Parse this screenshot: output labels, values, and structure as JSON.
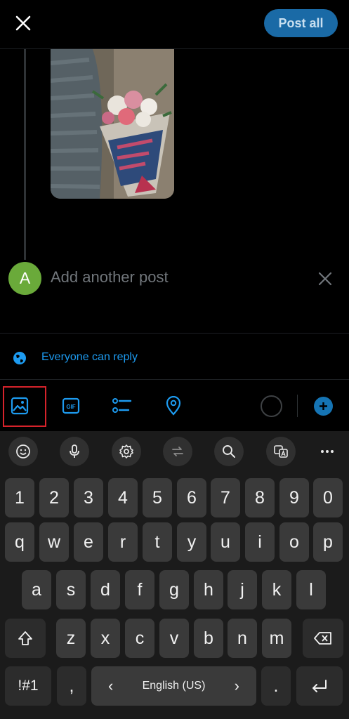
{
  "header": {
    "close_icon": "close-icon",
    "post_all_label": "Post all"
  },
  "composer": {
    "avatar_letter": "A",
    "add_post_placeholder": "Add another post"
  },
  "reply_setting": {
    "icon": "globe-icon",
    "label": "Everyone can reply"
  },
  "toolbar": {
    "items": [
      "image-icon",
      "gif-icon",
      "poll-icon",
      "location-icon"
    ],
    "gif_text": "GIF"
  },
  "keyboard": {
    "toolbar_icons": [
      "emoji-icon",
      "microphone-icon",
      "settings-icon",
      "swap-icon",
      "search-icon",
      "translate-icon",
      "more-icon"
    ],
    "number_row": [
      "1",
      "2",
      "3",
      "4",
      "5",
      "6",
      "7",
      "8",
      "9",
      "0"
    ],
    "row1": [
      "q",
      "w",
      "e",
      "r",
      "t",
      "y",
      "u",
      "i",
      "o",
      "p"
    ],
    "row2": [
      "a",
      "s",
      "d",
      "f",
      "g",
      "h",
      "j",
      "k",
      "l"
    ],
    "row3": [
      "z",
      "x",
      "c",
      "v",
      "b",
      "n",
      "m"
    ],
    "symbols_key": "!#1",
    "comma_key": ",",
    "space_label": "English (US)",
    "period_key": ".",
    "left_arrow": "‹",
    "right_arrow": "›"
  },
  "colors": {
    "accent": "#1d9bf0",
    "highlight": "#d6232b",
    "avatar": "#6aaa3a"
  }
}
